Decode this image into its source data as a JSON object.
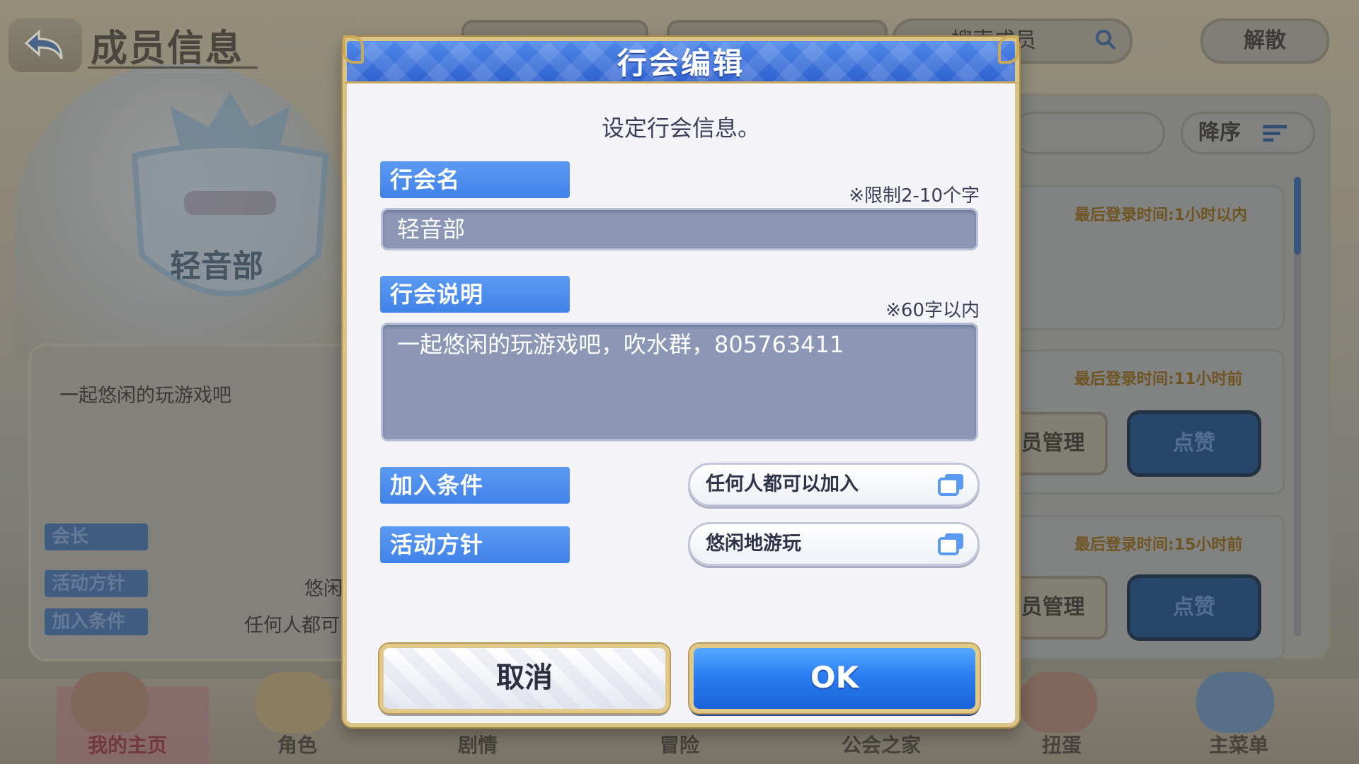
{
  "background": {
    "page_title": "成员信息",
    "guild_emblem_name": "轻音部",
    "guild_description": "一起悠闲的玩游戏吧",
    "left_tags": [
      "会长",
      "活动方针",
      "加入条件"
    ],
    "left_values": [
      "悠闲",
      "任何人都可"
    ],
    "search_placeholder": "搜索成员",
    "disband_label": "解散",
    "sort_label": "降序",
    "last_login_texts": [
      "最后登录时间:1小时以内",
      "最后登录时间:11小时前",
      "最后登录时间:15小时前"
    ],
    "member_manage_label": "员管理",
    "like_label": "点赞",
    "bottom_nav": [
      "我的主页",
      "角色",
      "剧情",
      "冒险",
      "公会之家",
      "扭蛋",
      "主菜单"
    ]
  },
  "dialog": {
    "title": "行会编辑",
    "subtitle": "设定行会信息。",
    "guild_name": {
      "label": "行会名",
      "hint": "※限制2-10个字",
      "value": "轻音部"
    },
    "guild_description": {
      "label": "行会说明",
      "hint": "※60字以内",
      "value": "一起悠闲的玩游戏吧，吹水群，805763411"
    },
    "join_condition": {
      "label": "加入条件",
      "selected": "任何人都可以加入"
    },
    "activity_policy": {
      "label": "活动方针",
      "selected": "悠闲地游玩"
    },
    "cancel_label": "取消",
    "ok_label": "OK"
  },
  "colors": {
    "header_blue": "#3a70da",
    "label_blue": "#4a8cee",
    "field_fill": "#8c97b5",
    "gold_border": "#d9c387",
    "ok_blue": "#2c7ef2"
  }
}
